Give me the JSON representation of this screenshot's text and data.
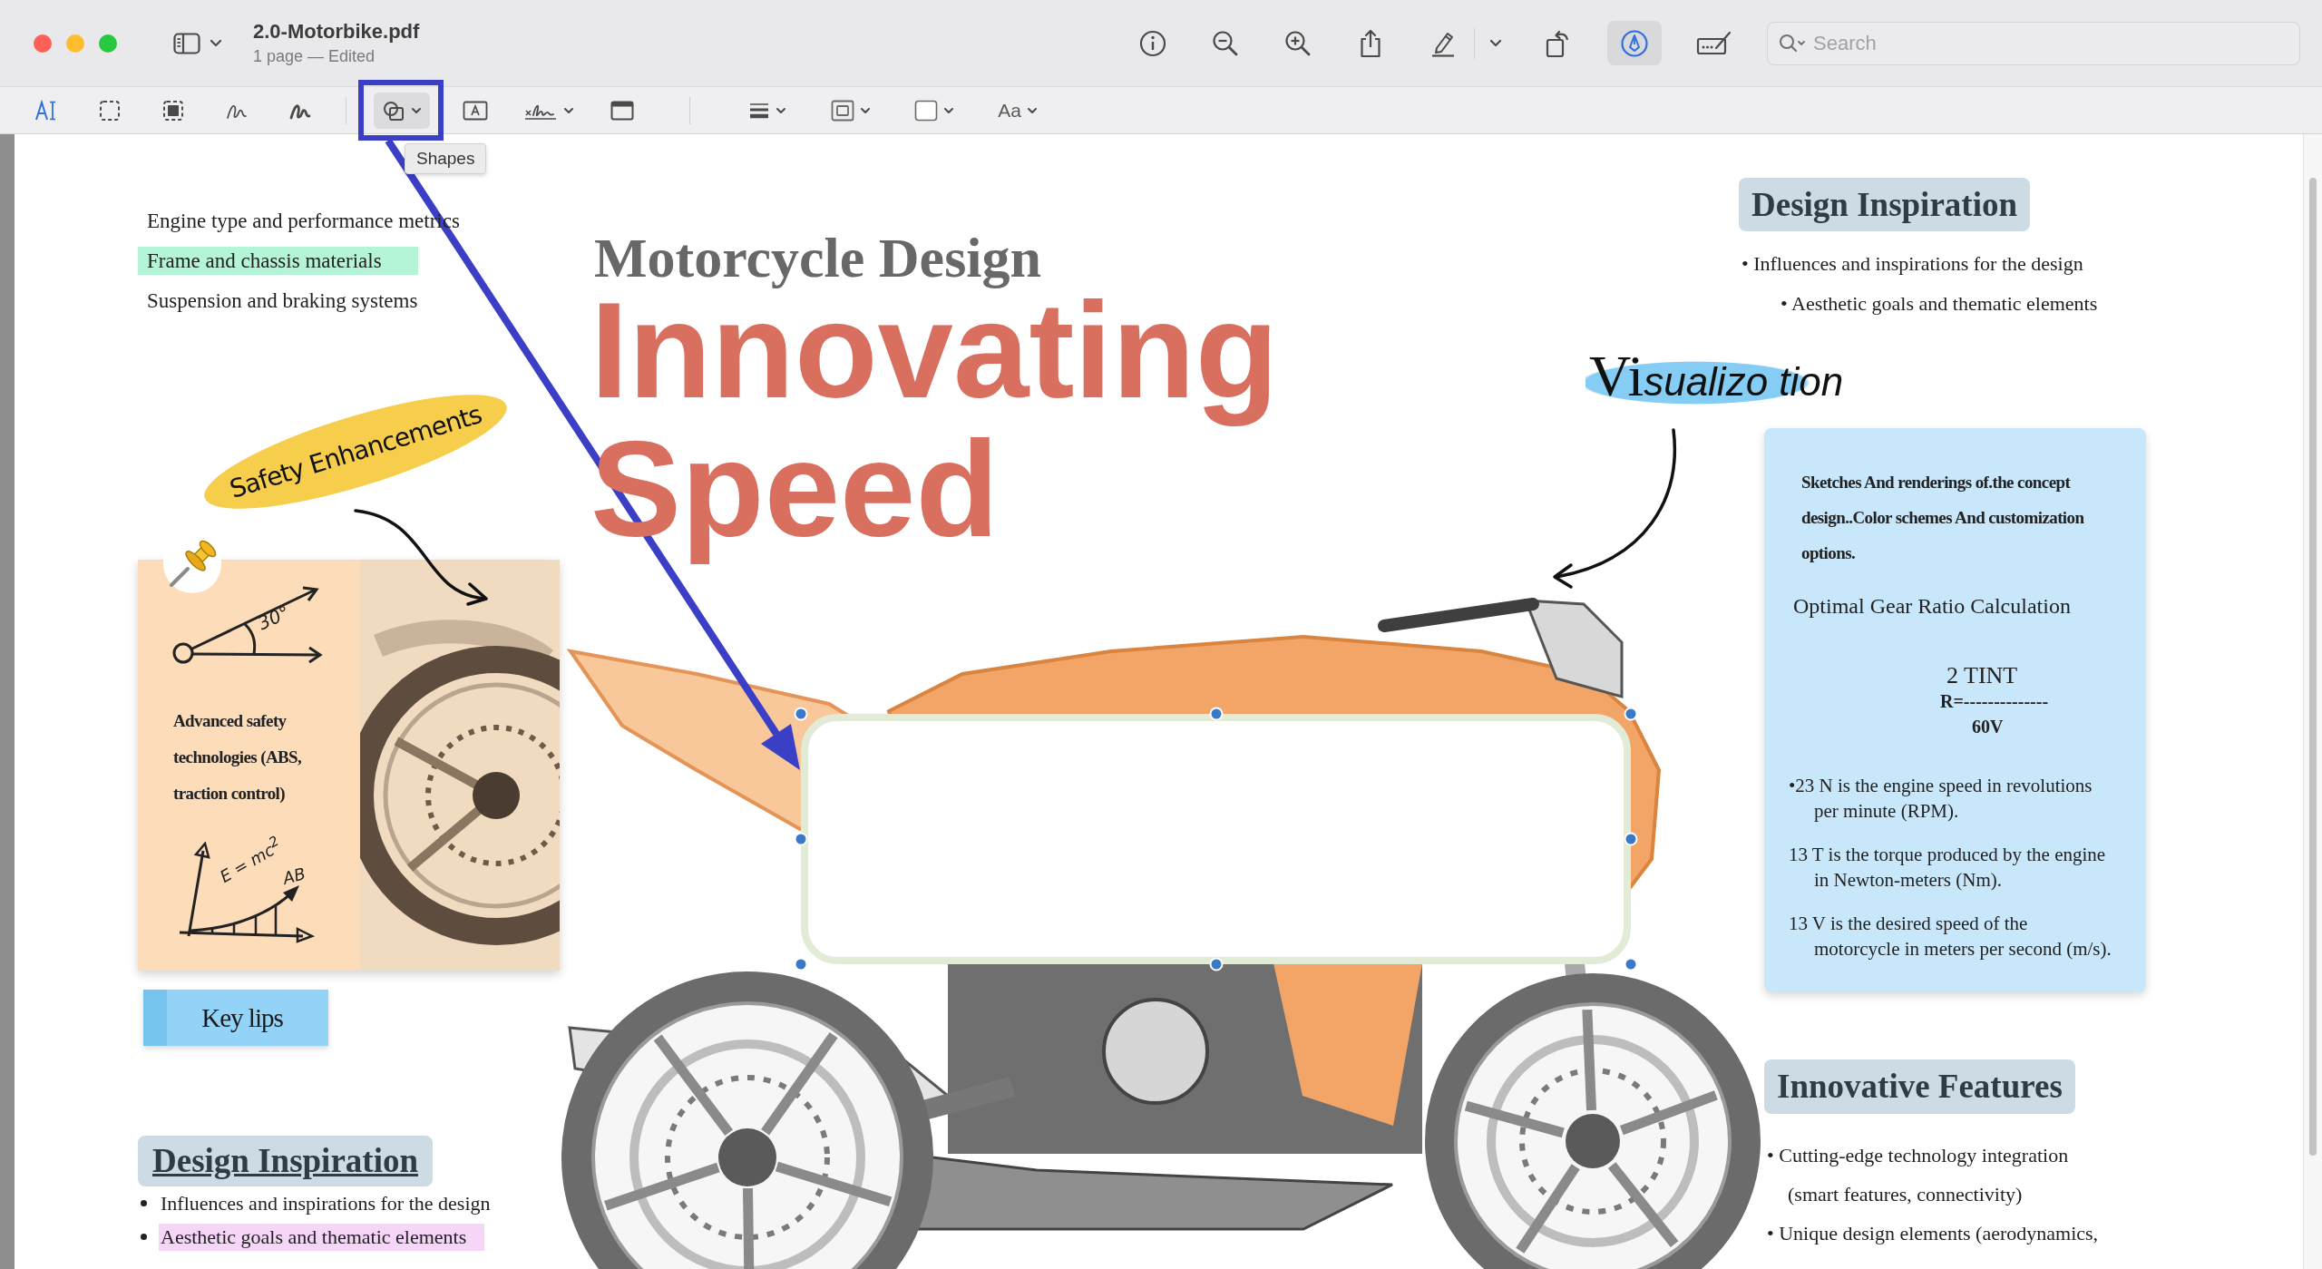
{
  "window": {
    "title": "2.0-Motorbike.pdf",
    "subtitle": "1 page — Edited",
    "markup_on": true,
    "search": {
      "placeholder": "Search"
    }
  },
  "markup_toolbar": {
    "shapes_tool": {
      "hovered": true,
      "tooltip": "Shapes"
    },
    "text_style": "Aa"
  },
  "page": {
    "topics": [
      {
        "text": "Engine type and performance metrics",
        "highlighted": false
      },
      {
        "text": "Frame and chassis materials",
        "highlighted": true
      },
      {
        "text": "Suspension and braking systems",
        "highlighted": false
      }
    ],
    "heading": "Motorcycle Design",
    "headline": [
      "Innovating",
      "Speed"
    ],
    "sticker": "Safety Enhancements",
    "safety_card": {
      "angle_label": "30°",
      "text": "Advanced safety technologies (ABS, traction control)",
      "formula": "E = mc$^{2}$",
      "curve_label": "AB"
    },
    "sticky_note": "Key lips",
    "inspiration_top": {
      "title": "Design Inspiration",
      "bullets": [
        {
          "text": "• Influences and inspirations for the design",
          "children": [
            {
              "text": "• Aesthetic goals and thematic elements"
            }
          ]
        }
      ]
    },
    "handwriting": {
      "initial": "Vi",
      "rest": "sualizo tion"
    },
    "info_card": {
      "intro": "Sketches And renderings of.the concept design..Color schemes And customization options.",
      "title": "Optimal Gear Ratio Calculation",
      "numerator": "2 TINT",
      "equation": "R=--------------",
      "denominator": "60V",
      "notes": [
        "•23 N is the engine speed in revolutions\nper minute (RPM).",
        "13 T is the torque produced by the engine\nin Newton-meters (Nm).",
        "13 V is the desired speed of the\nmotorcycle in meters per second (m/s)."
      ]
    },
    "inspiration_bottom": {
      "title": "Design Inspiration",
      "bullets": [
        {
          "text": "Influences and inspirations for the design",
          "highlighted": false
        },
        {
          "text": "Aesthetic goals and thematic elements",
          "highlighted": true
        }
      ]
    },
    "features": {
      "title": "Innovative Features",
      "bullets": [
        "• Cutting-edge technology integration\n(smart features, connectivity)",
        "• Unique design elements (aerodynamics,"
      ]
    }
  }
}
